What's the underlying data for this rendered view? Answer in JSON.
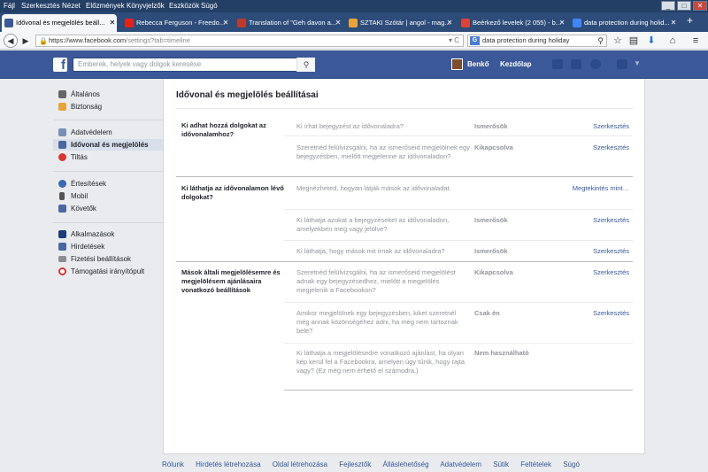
{
  "menubar": [
    "Fájl",
    "Szerkesztés",
    "Nézet",
    "Előzmények",
    "Könyvjelzők",
    "Eszközök",
    "Súgó"
  ],
  "window_controls": [
    "_",
    "□",
    "✕"
  ],
  "tabs": [
    {
      "label": "Idővonal és megjelölés beáll...",
      "active": true,
      "color": "#3b5998"
    },
    {
      "label": "Rebecca Ferguson - Freedo...",
      "active": false,
      "color": "#e62117"
    },
    {
      "label": "Translation of \"Geh davon a...",
      "active": false,
      "color": "#c0392b"
    },
    {
      "label": "SZTAKI Szótár | angol - mag...",
      "active": false,
      "color": "#e8a33d"
    },
    {
      "label": "Beérkező levelek (2 055) - b...",
      "active": false,
      "color": "#db4437"
    },
    {
      "label": "data protection during holid...",
      "active": false,
      "color": "#4285f4"
    }
  ],
  "nav": {
    "url_host": "https://www.facebook.com",
    "url_path": "/settings?tab=timeline",
    "search_engine": "G",
    "search_text": "data protection during holiday"
  },
  "fb": {
    "search_placeholder": "Emberek, helyek vagy dolgok keresése",
    "user": "Benkő",
    "home": "Kezdőlap"
  },
  "sidebar": [
    {
      "label": "Általános",
      "icon": "gears-icon",
      "color": "#666"
    },
    {
      "label": "Biztonság",
      "icon": "shield-icon",
      "color": "#e8a33d"
    },
    {
      "label": "Adatvédelem",
      "icon": "lock-icon",
      "color": "#7a8fb5"
    },
    {
      "label": "Idővonal és megjelölés",
      "icon": "timeline-icon",
      "color": "#4b67a1",
      "active": true
    },
    {
      "label": "Tiltás",
      "icon": "block-icon",
      "color": "#d93636"
    },
    {
      "label": "Értesítések",
      "icon": "globe-icon",
      "color": "#3a68b4"
    },
    {
      "label": "Mobil",
      "icon": "mobile-icon",
      "color": "#555"
    },
    {
      "label": "Követők",
      "icon": "rss-icon",
      "color": "#4b67a1"
    },
    {
      "label": "Alkalmazások",
      "icon": "apps-icon",
      "color": "#1d3c78"
    },
    {
      "label": "Hirdetések",
      "icon": "ads-icon",
      "color": "#4b67a1"
    },
    {
      "label": "Fizetési beállítások",
      "icon": "card-icon",
      "color": "#8a8d91"
    },
    {
      "label": "Támogatási irányítópult",
      "icon": "lifebuoy-icon",
      "color": "#d93636"
    }
  ],
  "main": {
    "title": "Idővonal és megjelölés beállításai",
    "sections": [
      {
        "heading": "Ki adhat hozzá dolgokat az idővonalamhoz?",
        "rows": [
          {
            "question": "Ki írhat bejegyzést az idővonaladra?",
            "value": "Ismerősök",
            "action": "Szerkesztés"
          },
          {
            "question": "Szeretnéd felülvizsgálni, ha az ismerőseid megjelölnek egy bejegyzésben, mielőtt megjelenne az idővonaladon?",
            "value": "Kikapcsolva",
            "action": "Szerkesztés"
          }
        ]
      },
      {
        "heading": "Ki láthatja az idővonalamon lévő dolgokat?",
        "rows": [
          {
            "question": "Megnézheted, hogyan látják mások az idővonaladat.",
            "value": "",
            "action": "Megtekintés mint…"
          },
          {
            "question": "Ki láthatja azokat a bejegyzéseket az idővonaladon, amelyekben meg vagy jelölve?",
            "value": "Ismerősök",
            "action": "Szerkesztés"
          },
          {
            "question": "Ki láthatja, hogy mások mit írnak az idővonaladra?",
            "value": "Ismerősök",
            "action": "Szerkesztés"
          }
        ]
      },
      {
        "heading": "Mások általi megjelölésemre és megjelölésem ajánlásaira vonatkozó beállítások",
        "rows": [
          {
            "question": "Szeretnéd felülvizsgálni, ha az ismerőseid megjelölést adnak egy bejegyzésedhez, mielőtt a megjelölés megjelenik a Facebookon?",
            "value": "Kikapcsolva",
            "action": "Szerkesztés"
          },
          {
            "question": "Amikor megjelölnek egy bejegyzésben, kiket szeretnél még annak közönségéhez adni, ha még nem tartoznak bele?",
            "value": "Csak én",
            "action": "Szerkesztés"
          },
          {
            "question": "Ki láthatja a megjelölésedre vonatkozó ajánlást, ha olyan kép kerül fel a Facebookra, amelyen úgy tűnik, hogy rajta vagy? (Ez még nem érhető el számodra.)",
            "value": "Nem használható",
            "action": ""
          }
        ]
      }
    ]
  },
  "footer": [
    "Rólunk",
    "Hirdetés létrehozása",
    "Oldal létrehozása",
    "Fejlesztők",
    "Álláslehetőség",
    "Adatvédelem",
    "Sütik",
    "Feltételek",
    "Súgó"
  ]
}
